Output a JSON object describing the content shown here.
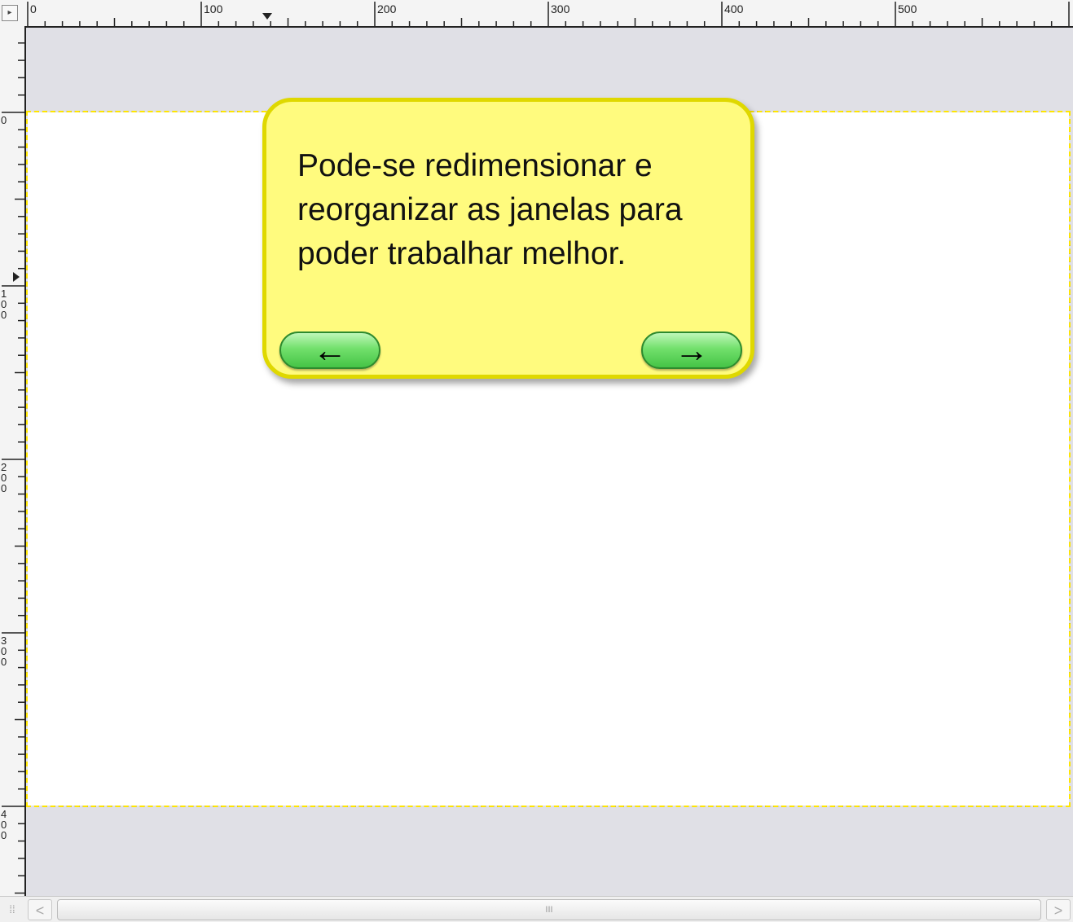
{
  "ruler": {
    "h_labels": [
      "0",
      "100",
      "200",
      "300",
      "400",
      "500"
    ],
    "v_labels": [
      "0",
      "100",
      "200",
      "300",
      "400"
    ]
  },
  "tooltip": {
    "text": "Pode-se redimensionar e reorganizar as janelas para poder trabalhar melhor.",
    "back_icon": "←",
    "next_icon": "→"
  },
  "scrollbar": {
    "thumb_grip": "III",
    "left_icon": "<",
    "right_icon": ">"
  },
  "colors": {
    "tooltip_bg": "#fffb7e",
    "tooltip_border": "#dfd800",
    "button_green": "#72e06c",
    "selection_dash": "#ffe600"
  }
}
